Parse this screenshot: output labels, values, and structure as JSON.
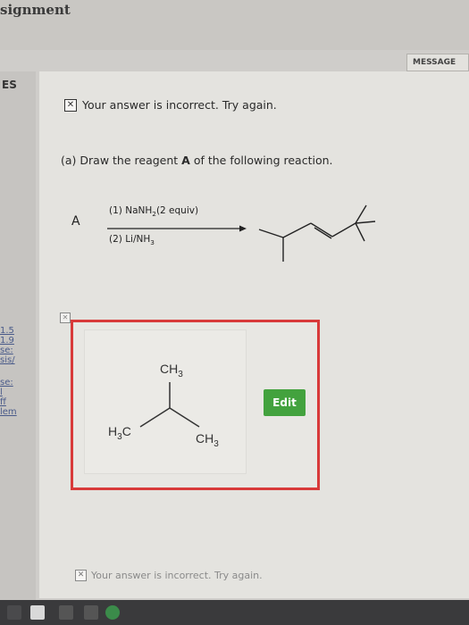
{
  "header": {
    "app_title": "signment",
    "messages_label": "MESSAGE"
  },
  "sidebar": {
    "section_label": "ES",
    "links": [
      "1.5",
      "1.9",
      "se:",
      "sis/",
      "se:",
      "l",
      "ff",
      "lem"
    ]
  },
  "feedback_top": {
    "icon": "x-icon",
    "text": "Your answer is incorrect.  Try again."
  },
  "question": {
    "part": "(a)",
    "text_before": "Draw the reagent ",
    "reagent": "A",
    "text_after": " of the following reaction."
  },
  "reaction": {
    "reagent_label": "A",
    "condition1_prefix": "(1) NaNH",
    "condition1_sub": "2",
    "condition1_suffix": "(2 equiv)",
    "condition2_prefix": "(2) Li/NH",
    "condition2_sub": "3"
  },
  "answer": {
    "ch3_top": "CH",
    "ch3_top_sub": "3",
    "h3c_left_prefix": "H",
    "h3c_left_sub": "3",
    "h3c_left_suffix": "C",
    "ch3_right": "CH",
    "ch3_right_sub": "3",
    "edit_label": "Edit"
  },
  "feedback_bottom": {
    "icon": "x-icon",
    "text": "Your answer is incorrect.  Try again."
  },
  "colors": {
    "error": "#d83a3a",
    "edit_button": "#43a23e"
  }
}
